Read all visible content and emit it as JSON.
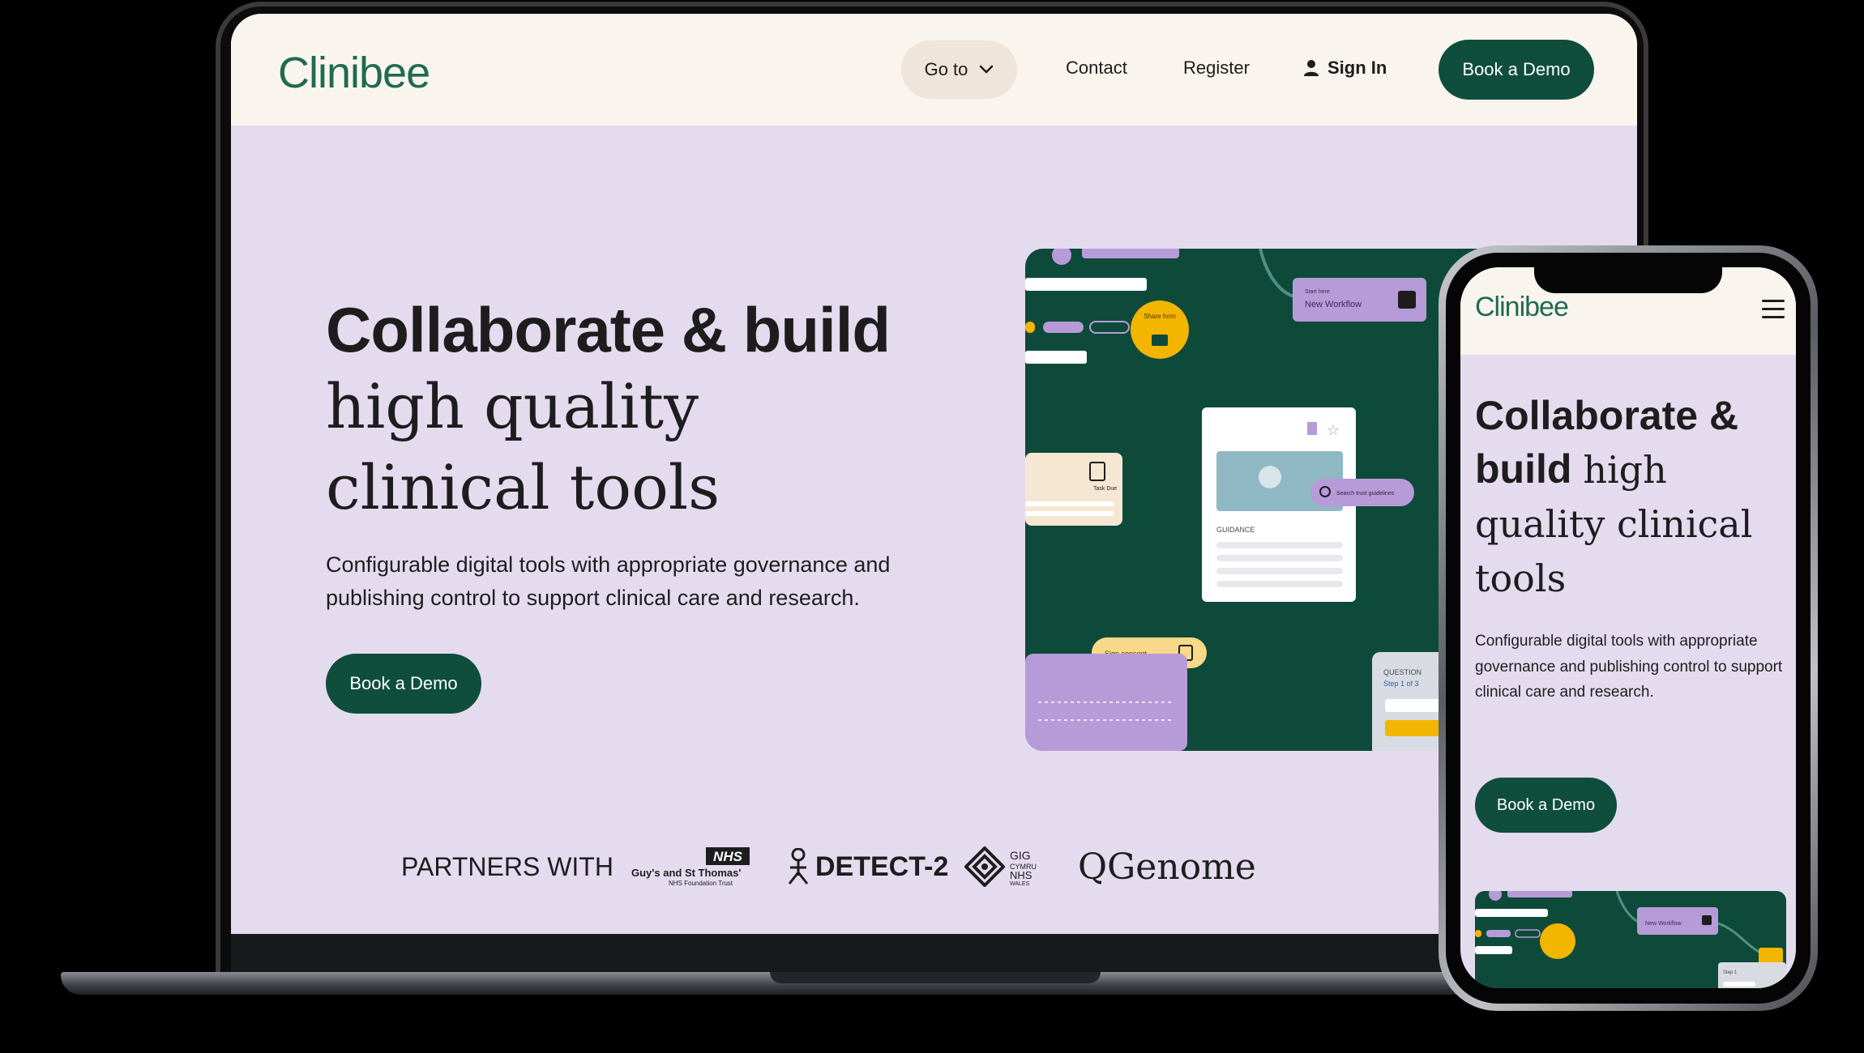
{
  "brand": {
    "name": "Clinibee",
    "accent": "#0f4e3c",
    "logo_color": "#1f6a52",
    "hero_bg": "#e4dbef",
    "header_bg": "#f9f5ee"
  },
  "nav": {
    "goto_label": "Go to",
    "contact_label": "Contact",
    "register_label": "Register",
    "signin_label": "Sign In",
    "demo_label": "Book a Demo"
  },
  "hero": {
    "line1": "Collaborate & build",
    "line2": "high quality",
    "line3": "clinical tools",
    "subtitle": "Configurable digital tools with appropriate governance and publishing control to support clinical care and research.",
    "cta_label": "Book a Demo"
  },
  "partners": {
    "label": "PARTNERS WITH",
    "logos": [
      {
        "name": "Guy's and St Thomas' NHS Foundation Trust",
        "icon": "nhs-logo"
      },
      {
        "name": "DETECT-2",
        "icon": "detect2-logo"
      },
      {
        "name": "GIG Cymru NHS Wales",
        "icon": "nhs-wales-logo"
      },
      {
        "name": "QGenome",
        "icon": "qgenome-logo"
      }
    ]
  },
  "illustration": {
    "start_here": "Start here",
    "new_workflow": "New Workflow",
    "share_form": "Share form",
    "task_due": "Task Due",
    "search_placeholder": "Search trust guidelines",
    "guidance": "GUIDANCE",
    "sign_consent": "Sign consent",
    "question": "QUESTION",
    "step": "Step 1 of 3"
  },
  "mobile": {
    "brand": "Clinibee",
    "h_bold1": "Collaborate &",
    "h_bold2": "build",
    "h_serif1": "high",
    "h_serif2": "quality clinical",
    "h_serif3": "tools",
    "subtitle": "Configurable digital tools with appropriate governance and publishing control to support clinical care and research.",
    "cta_label": "Book a Demo",
    "step": "Step 1"
  }
}
